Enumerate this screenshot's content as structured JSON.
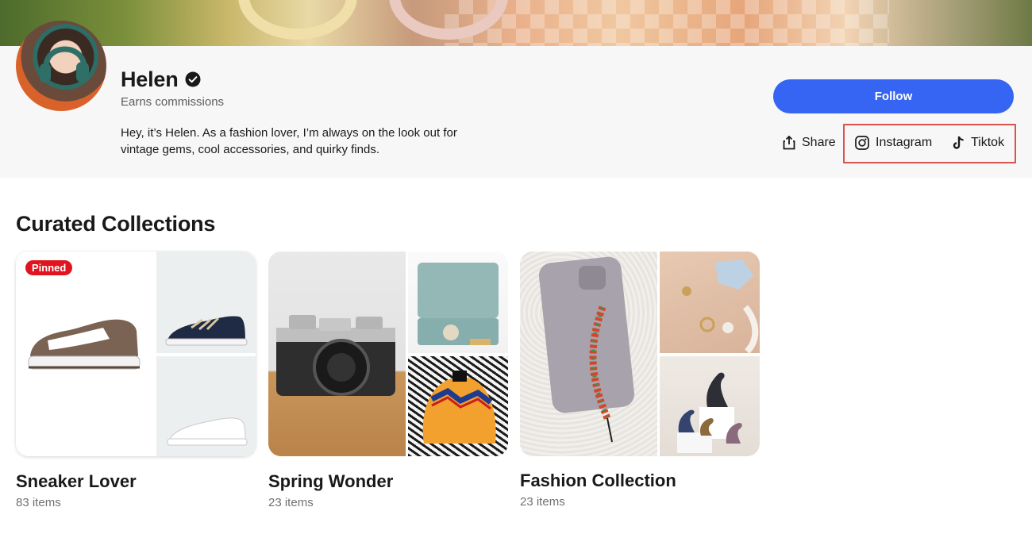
{
  "profile": {
    "name": "Helen",
    "subtitle": "Earns commissions",
    "bio": "Hey, it’s Helen. As a fashion lover, I’m always on the look out for vintage gems, cool accessories, and quirky finds.",
    "verified_icon": "verified-badge-icon"
  },
  "actions": {
    "follow_label": "Follow",
    "share_label": "Share",
    "instagram_label": "Instagram",
    "tiktok_label": "Tiktok"
  },
  "collections_section": {
    "title": "Curated Collections"
  },
  "collections": [
    {
      "title": "Sneaker Lover",
      "count": "83 items",
      "badge": "Pinned"
    },
    {
      "title": "Spring Wonder",
      "count": "23 items"
    },
    {
      "title": "Fashion Collection",
      "count": "23 items"
    }
  ],
  "colors": {
    "accent": "#3665f3",
    "pinned_badge": "#e0141e",
    "highlight_box": "#d9534f",
    "header_bg": "#f7f7f7"
  }
}
